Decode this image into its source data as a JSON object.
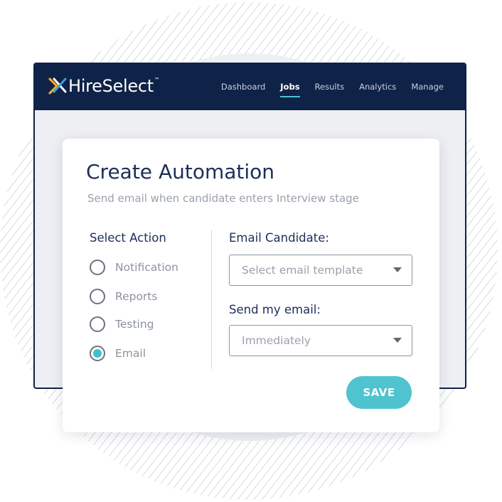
{
  "app": {
    "brand": "HireSelect",
    "brand_tm": "™",
    "brand_colors": {
      "navy": "#0f2248",
      "accent": "#4fc3cf",
      "logo_orange": "#f5a623",
      "logo_blue": "#3aa0d8"
    },
    "logo_icon": "x-mark-logo-icon"
  },
  "nav": {
    "items": [
      {
        "label": "Dashboard",
        "active": false
      },
      {
        "label": "Jobs",
        "active": true
      },
      {
        "label": "Results",
        "active": false
      },
      {
        "label": "Analytics",
        "active": false
      },
      {
        "label": "Manage",
        "active": false
      }
    ]
  },
  "dialog": {
    "title": "Create Automation",
    "subtitle": "Send email when candidate enters Interview stage",
    "action_header": "Select Action",
    "actions": [
      {
        "label": "Notification",
        "selected": false
      },
      {
        "label": "Reports",
        "selected": false
      },
      {
        "label": "Testing",
        "selected": false
      },
      {
        "label": "Email",
        "selected": true
      }
    ],
    "email_candidate_label": "Email Candidate:",
    "template_select": {
      "value": "Select email template",
      "icon": "caret-down-icon"
    },
    "send_label": "Send my email:",
    "timing_select": {
      "value": "Immediately",
      "icon": "caret-down-icon"
    },
    "save_label": "SAVE"
  }
}
